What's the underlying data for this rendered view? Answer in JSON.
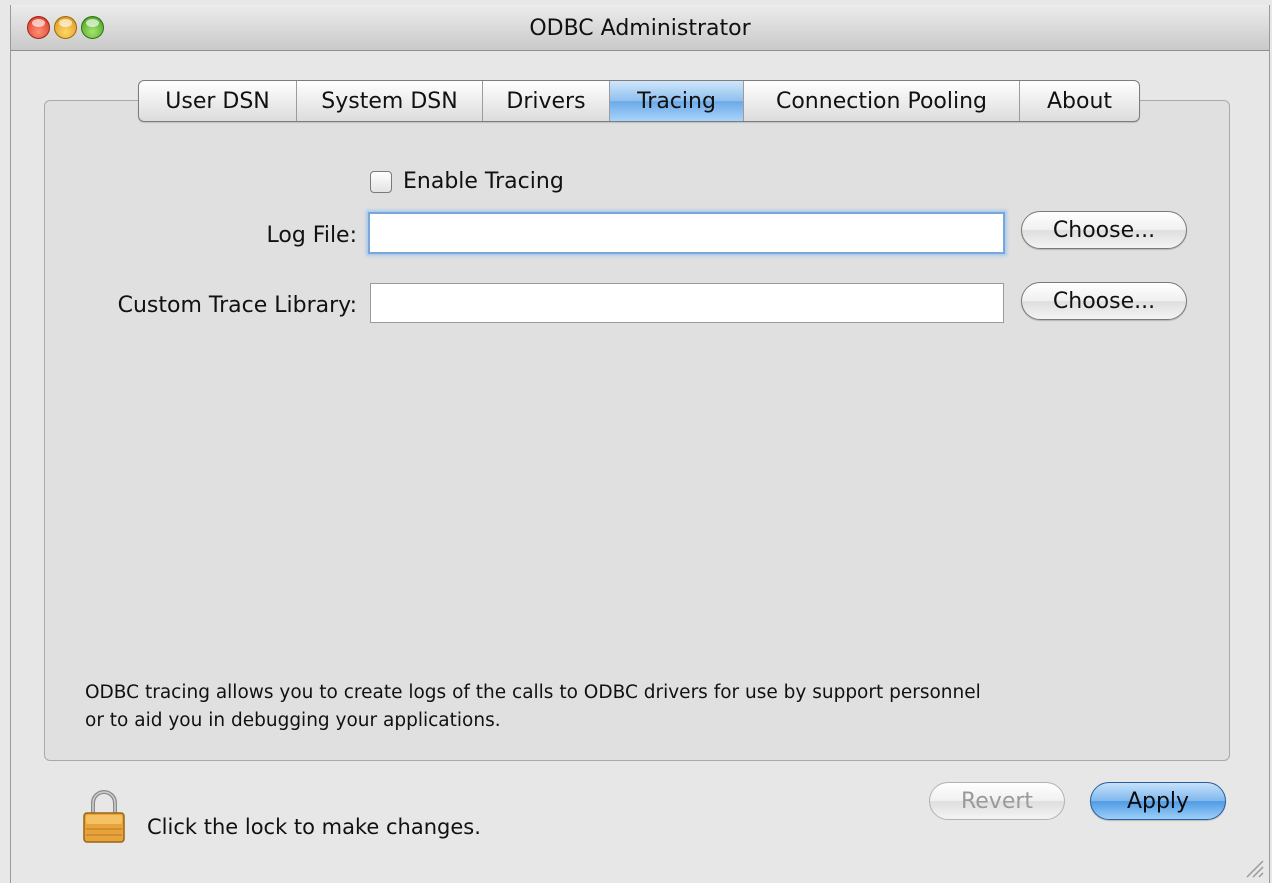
{
  "window": {
    "title": "ODBC Administrator"
  },
  "tabs": [
    {
      "label": "User DSN",
      "active": false
    },
    {
      "label": "System DSN",
      "active": false
    },
    {
      "label": "Drivers",
      "active": false
    },
    {
      "label": "Tracing",
      "active": true
    },
    {
      "label": "Connection Pooling",
      "active": false
    },
    {
      "label": "About",
      "active": false
    }
  ],
  "tracing": {
    "enable_label": "Enable Tracing",
    "enable_checked": false,
    "log_file_label": "Log File:",
    "log_file_value": "",
    "custom_trace_label": "Custom Trace Library:",
    "custom_trace_value": "",
    "choose_label": "Choose...",
    "help_line1": "ODBC tracing allows you to create logs of the calls to ODBC drivers for use by support personnel",
    "help_line2": "or to aid you in debugging your applications."
  },
  "footer": {
    "lock_text": "Click the lock to make changes.",
    "revert_label": "Revert",
    "apply_label": "Apply"
  },
  "colors": {
    "accent": "#6da9e8",
    "lock": "#e8a33a"
  }
}
